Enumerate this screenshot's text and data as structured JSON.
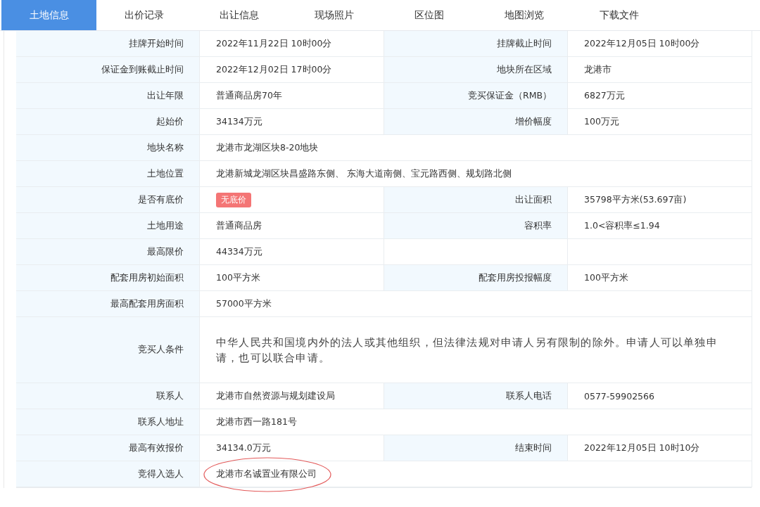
{
  "tabs": [
    {
      "label": "土地信息",
      "selected": true
    },
    {
      "label": "出价记录",
      "selected": false
    },
    {
      "label": "出让信息",
      "selected": false
    },
    {
      "label": "现场照片",
      "selected": false
    },
    {
      "label": "区位图",
      "selected": false
    },
    {
      "label": "地图浏览",
      "selected": false
    },
    {
      "label": "下载文件",
      "selected": false
    }
  ],
  "rows": [
    {
      "kind": "pair",
      "label": "挂牌开始时间",
      "value": "2022年11月22日 10时00分",
      "label_2": "挂牌截止时间",
      "value_2": "2022年12月05日 10时00分"
    },
    {
      "kind": "pair",
      "label": "保证金到账截止时间",
      "value": "2022年12月02日 17时00分",
      "label_2": "地块所在区域",
      "value_2": "龙港市"
    },
    {
      "kind": "pair",
      "label": "出让年限",
      "value": "普通商品房70年",
      "label_2": "竞买保证金（RMB）",
      "value_2": "6827万元"
    },
    {
      "kind": "pair",
      "label": "起始价",
      "value": "34134万元",
      "label_2": "增价幅度",
      "value_2": "100万元"
    },
    {
      "kind": "full",
      "label": "地块名称",
      "value": "龙港市龙湖区块8-20地块"
    },
    {
      "kind": "full",
      "label": "土地位置",
      "value": "龙港新城龙湖区块昌盛路东侧、 东海大道南侧、宝元路西侧、规划路北侧"
    },
    {
      "kind": "pair",
      "label": "是否有底价",
      "value": "无底价",
      "badge": true,
      "label_2": "出让面积",
      "value_2": "35798平方米(53.697亩)"
    },
    {
      "kind": "pair",
      "label": "土地用途",
      "value": "普通商品房",
      "label_2": "容积率",
      "value_2": "1.0<容积率≤1.94"
    },
    {
      "kind": "half",
      "label": "最高限价",
      "value": "44334万元"
    },
    {
      "kind": "pair",
      "label": "配套用房初始面积",
      "value": "100平方米",
      "label_2": "配套用房投报幅度",
      "value_2": "100平方米"
    },
    {
      "kind": "full",
      "label": "最高配套用房面积",
      "value": "57000平方米"
    },
    {
      "kind": "text",
      "label": "竞买人条件",
      "value": "中华人民共和国境内外的法人或其他组织，但法律法规对申请人另有限制的除外。申请人可以单独申请，也可以联合申请。"
    },
    {
      "kind": "pair",
      "label": "联系人",
      "value": "龙港市自然资源与规划建设局",
      "label_2": "联系人电话",
      "value_2": "0577-59902566"
    },
    {
      "kind": "full",
      "label": "联系人地址",
      "value": "龙港市西一路181号"
    },
    {
      "kind": "pair",
      "label": "最高有效报价",
      "value": "34134.0万元",
      "label_2": "结束时间",
      "value_2": "2022年12月05日 10时10分"
    },
    {
      "kind": "full",
      "label": "竞得入选人",
      "value": "龙港市名诚置业有限公司",
      "circled": true
    }
  ]
}
